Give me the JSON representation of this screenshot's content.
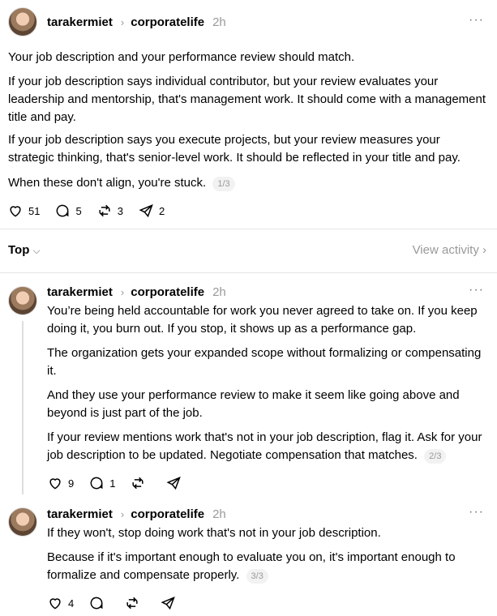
{
  "posts": [
    {
      "user": "tarakermiet",
      "community": "corporatelife",
      "time": "2h",
      "paragraphs": [
        "Your job description and your performance review should match.",
        "If your job description says individual contributor, but your review evaluates your leadership and mentorship, that's management work. It should come with a management title and pay.",
        "If your job description says you execute projects, but your review measures your strategic thinking, that's senior-level work. It should be reflected in your title and pay.",
        "When these don't align, you're stuck."
      ],
      "page": "1/3",
      "likes": "51",
      "replies": "5",
      "reposts": "3",
      "shares": "2"
    },
    {
      "user": "tarakermiet",
      "community": "corporatelife",
      "time": "2h",
      "paragraphs": [
        "You’re being held accountable for work you never agreed to take on. If you keep doing it, you burn out. If you stop, it shows up as a performance gap.",
        "The organization gets your expanded scope without formalizing or compensating it.",
        "And they use your performance review to make it seem like going above and beyond is just part of the job.",
        "If your review mentions work that's not in your job description, flag it. Ask for your job description to be updated. Negotiate compensation that matches."
      ],
      "page": "2/3",
      "likes": "9",
      "replies": "1",
      "reposts": "",
      "shares": ""
    },
    {
      "user": "tarakermiet",
      "community": "corporatelife",
      "time": "2h",
      "paragraphs": [
        "If they won't, stop doing work that's not in your job description.",
        "Because if it's important enough to evaluate you on, it's important enough to formalize and compensate properly."
      ],
      "page": "3/3",
      "likes": "4",
      "replies": "",
      "reposts": "",
      "shares": ""
    }
  ],
  "sort": {
    "label": "Top",
    "view_activity": "View activity"
  },
  "icons": {
    "more": "more-icon",
    "like": "heart-icon",
    "reply": "comment-icon",
    "repost": "repost-icon",
    "share": "share-icon"
  }
}
